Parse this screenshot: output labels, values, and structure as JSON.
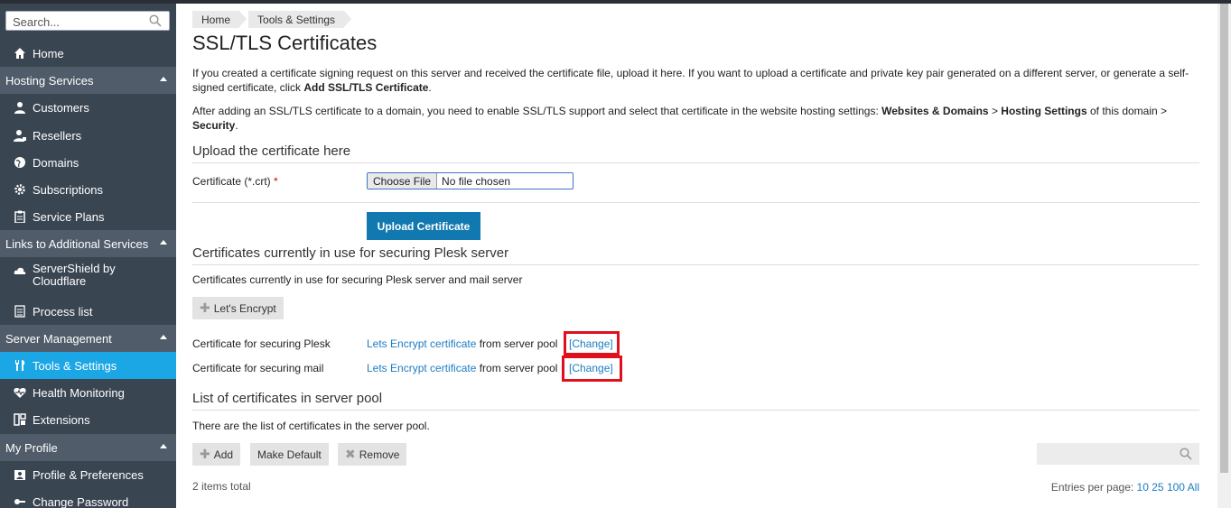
{
  "sidebar": {
    "search_placeholder": "Search...",
    "home": "Home",
    "sections": [
      {
        "title": "Hosting Services",
        "items": [
          "Customers",
          "Resellers",
          "Domains",
          "Subscriptions",
          "Service Plans"
        ]
      },
      {
        "title": "Links to Additional Services",
        "items": [
          "ServerShield by Cloudflare",
          "Process list"
        ]
      },
      {
        "title": "Server Management",
        "items": [
          "Tools & Settings",
          "Health Monitoring",
          "Extensions"
        ]
      },
      {
        "title": "My Profile",
        "items": [
          "Profile & Preferences",
          "Change Password"
        ]
      }
    ],
    "active_item": "Tools & Settings"
  },
  "breadcrumb": [
    "Home",
    "Tools & Settings"
  ],
  "page_title": "SSL/TLS Certificates",
  "intro": {
    "p1_a": "If you created a certificate signing request on this server and received the certificate file, upload it here. If you want to upload a certificate and private key pair generated on a different server, or generate a self-signed certificate, click ",
    "p1_b": "Add SSL/TLS Certificate",
    "p1_c": ".",
    "p2_a": "After adding an SSL/TLS certificate to a domain, you need to enable SSL/TLS support and select that certificate in the website hosting settings: ",
    "p2_b": "Websites & Domains",
    "p2_c": " > ",
    "p2_d": "Hosting Settings",
    "p2_e": " of this domain > ",
    "p2_f": "Security",
    "p2_g": "."
  },
  "upload": {
    "section_title": "Upload the certificate here",
    "cert_label": "Certificate (*.crt)",
    "required_mark": "*",
    "choose_file": "Choose File",
    "no_file": "No file chosen",
    "upload_button": "Upload Certificate"
  },
  "in_use": {
    "section_title": "Certificates currently in use for securing Plesk server",
    "description": "Certificates currently in use for securing Plesk server and mail server",
    "lets_encrypt_button": "Let's Encrypt",
    "rows": [
      {
        "label": "Certificate for securing Plesk",
        "link": "Lets Encrypt certificate",
        "suffix": " from server pool",
        "change": "[Change]"
      },
      {
        "label": "Certificate for securing mail",
        "link": "Lets Encrypt certificate",
        "suffix": " from server pool",
        "change": "[Change]"
      }
    ]
  },
  "pool": {
    "section_title": "List of certificates in server pool",
    "description": "There are the list of certificates in the server pool.",
    "add": "Add",
    "make_default": "Make Default",
    "remove": "Remove",
    "total": "2 items total",
    "entries_label": "Entries per page:",
    "entries_options": [
      "10",
      "25",
      "100",
      "All"
    ]
  },
  "colors": {
    "sidebar_bg": "#3a4552",
    "section_bg": "#515c6a",
    "active": "#1ba6e6",
    "primary_button": "#1279b0",
    "link": "#1c7dc2",
    "highlight": "#e0111d"
  }
}
